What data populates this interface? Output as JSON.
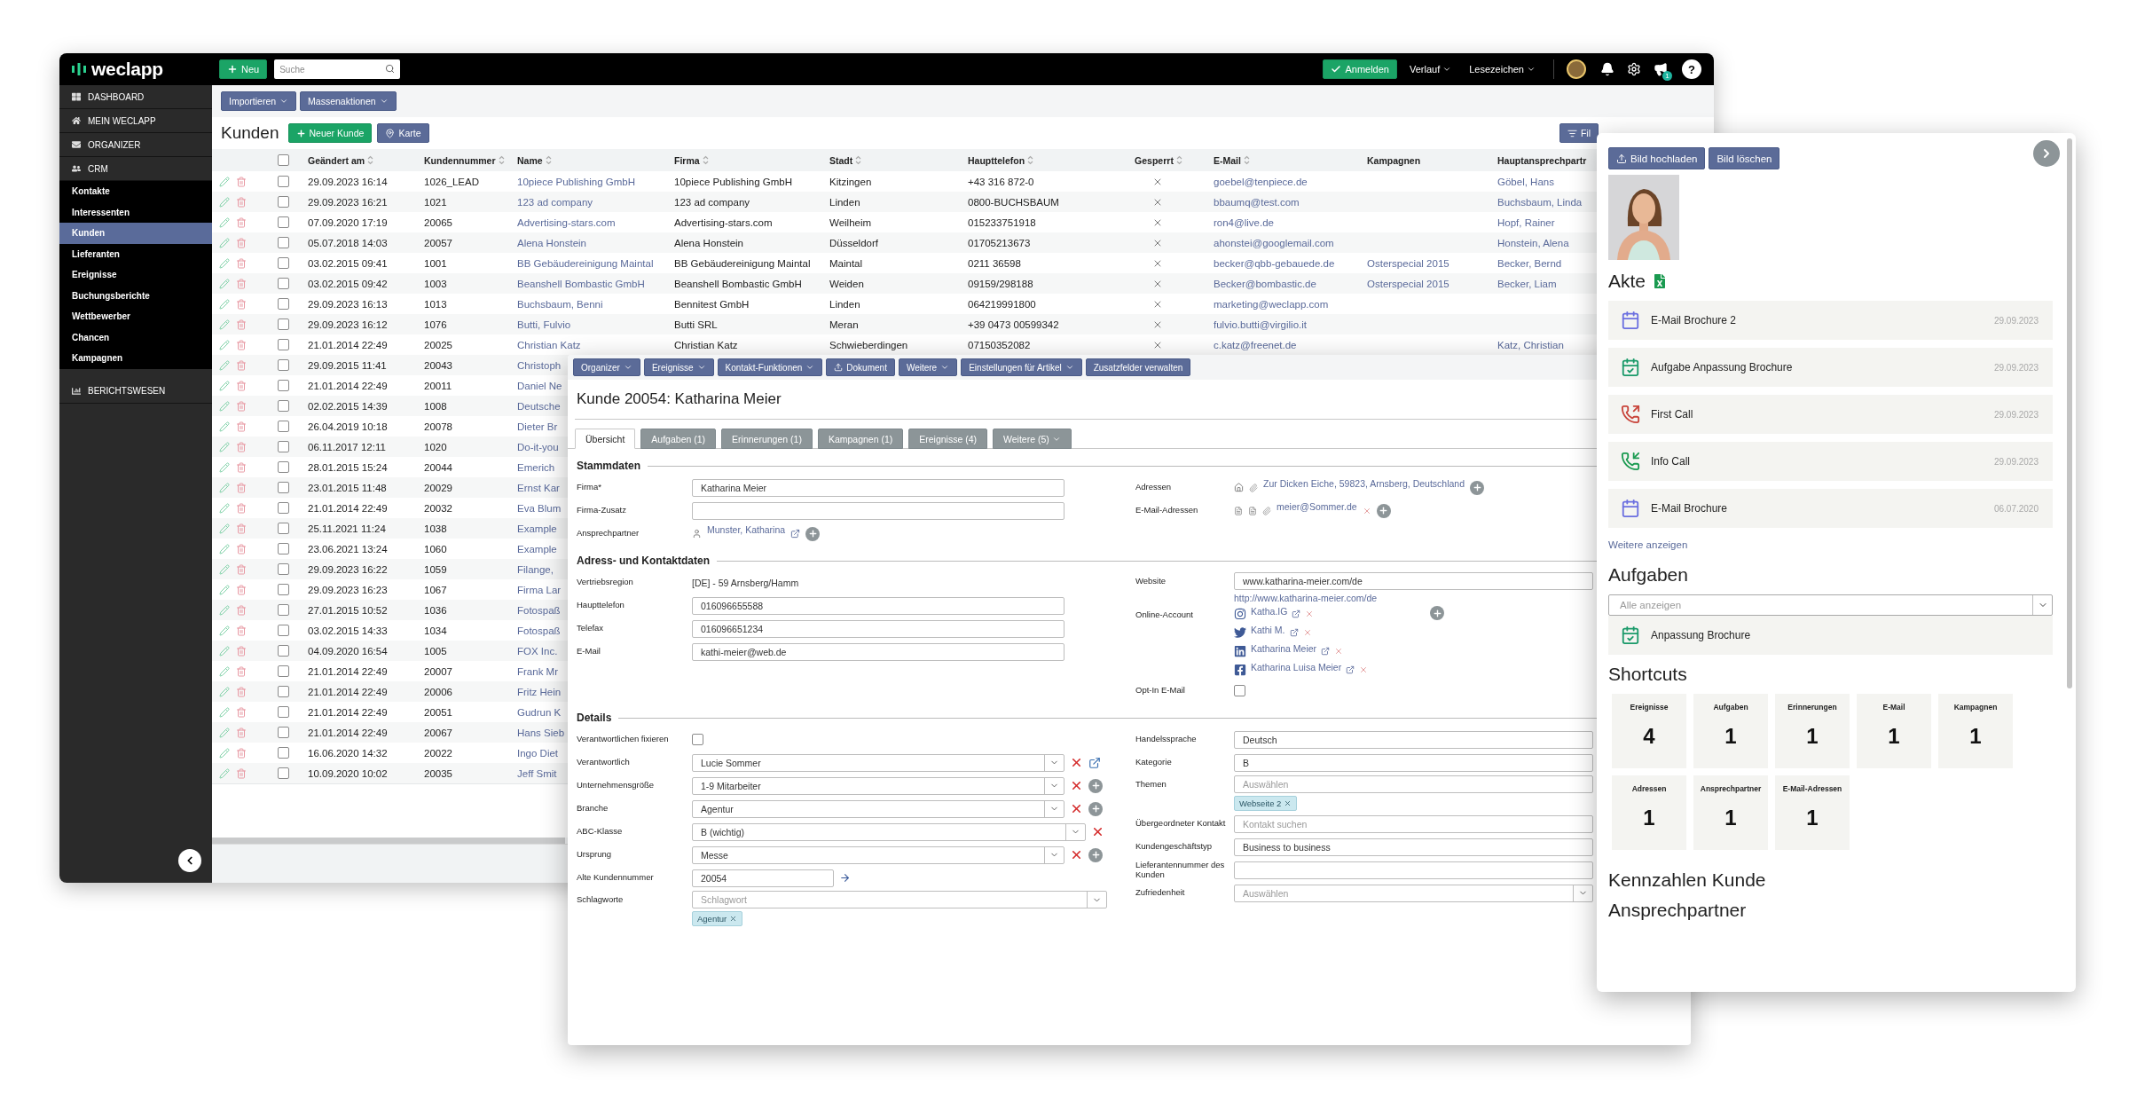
{
  "back_window": {
    "logo": "weclapp",
    "new_button": "Neu",
    "search": {
      "placeholder": "Suche"
    },
    "login_button": "Anmelden",
    "menus": [
      "Verlauf",
      "Lesezeichen"
    ],
    "notification_badge": "1",
    "help_button": "?",
    "sidebar": {
      "items": [
        {
          "label": "DASHBOARD",
          "kind": "section",
          "selected": false
        },
        {
          "label": "MEIN WECLAPP",
          "kind": "section",
          "selected": false
        },
        {
          "label": "ORGANIZER",
          "kind": "section",
          "selected": false
        },
        {
          "label": "CRM",
          "kind": "section",
          "selected": false
        },
        {
          "label": "Kontakte",
          "kind": "item",
          "selected": false
        },
        {
          "label": "Interessenten",
          "kind": "item",
          "selected": false
        },
        {
          "label": "Kunden",
          "kind": "item",
          "selected": true
        },
        {
          "label": "Lieferanten",
          "kind": "item",
          "selected": false
        },
        {
          "label": "Ereignisse",
          "kind": "item",
          "selected": false
        },
        {
          "label": "Buchungsberichte",
          "kind": "item",
          "selected": false
        },
        {
          "label": "Wettbewerber",
          "kind": "item",
          "selected": false
        },
        {
          "label": "Chancen",
          "kind": "item",
          "selected": false
        },
        {
          "label": "Kampagnen",
          "kind": "item",
          "selected": false
        },
        {
          "label": "BERICHTSWESEN",
          "kind": "section",
          "selected": false
        }
      ]
    },
    "toolbar_buttons": [
      "Importieren",
      "Massenaktionen"
    ],
    "page_title": "Kunden",
    "title_buttons": [
      {
        "label": "Neuer Kunde",
        "kind": "primary"
      },
      {
        "label": "Karte",
        "kind": "map"
      }
    ],
    "filter_button": "Fil",
    "table": {
      "select_all": {
        "checked": false
      },
      "columns": [
        {
          "label": "Geändert am",
          "sortable": true
        },
        {
          "label": "Kundennummer",
          "sortable": true
        },
        {
          "label": "Name",
          "sortable": true
        },
        {
          "label": "Firma",
          "sortable": true
        },
        {
          "label": "Stadt",
          "sortable": true
        },
        {
          "label": "Haupttelefon",
          "sortable": true
        },
        {
          "label": "Gesperrt",
          "sortable": true
        },
        {
          "label": "E-Mail",
          "sortable": true
        },
        {
          "label": "Kampagnen",
          "sortable": false
        },
        {
          "label": "Hauptansprechpartr",
          "sortable": false
        }
      ],
      "rows": [
        {
          "checked": false,
          "changed": "29.09.2023 16:14",
          "number": "1026_LEAD",
          "name": "10piece Publishing GmbH",
          "company": "10piece Publishing GmbH",
          "city": "Kitzingen",
          "phone": "+43 316 872-0",
          "locked": false,
          "email": "goebel@tenpiece.de",
          "contact": "Göbel, Hans"
        },
        {
          "checked": false,
          "changed": "29.09.2023 16:21",
          "number": "1021",
          "name": "123 ad company",
          "company": "123 ad company",
          "city": "Linden",
          "phone": "0800-BUCHSBAUM",
          "locked": false,
          "email": "bbaumq@test.com",
          "contact": "Buchsbaum, Linda"
        },
        {
          "checked": false,
          "changed": "07.09.2020 17:19",
          "number": "20065",
          "name": "Advertising-stars.com",
          "company": "Advertising-stars.com",
          "city": "Weilheim",
          "phone": "015233751918",
          "locked": false,
          "email": "ron4@live.de",
          "contact": "Hopf, Rainer"
        },
        {
          "checked": false,
          "changed": "05.07.2018 14:03",
          "number": "20057",
          "name": "Alena Honstein",
          "company": "Alena Honstein",
          "city": "Düsseldorf",
          "phone": "01705213673",
          "locked": false,
          "email": "ahonstei@googlemail.com",
          "contact": "Honstein, Alena"
        },
        {
          "checked": false,
          "changed": "03.02.2015 09:41",
          "number": "1001",
          "name": "BB Gebäudereinigung Maintal",
          "company": "BB Gebäudereinigung Maintal",
          "city": "Maintal",
          "phone": "0211 36598",
          "locked": false,
          "email": "becker@qbb-gebauede.de",
          "campaign": "Osterspecial 2015",
          "contact": "Becker, Bernd"
        },
        {
          "checked": false,
          "changed": "03.02.2015 09:42",
          "number": "1003",
          "name": "Beanshell Bombastic GmbH",
          "company": "Beanshell Bombastic GmbH",
          "city": "Weiden",
          "phone": "09159/298188",
          "locked": false,
          "email": "Becker@bombastic.de",
          "campaign": "Osterspecial 2015",
          "contact": "Becker, Liam"
        },
        {
          "checked": false,
          "changed": "29.09.2023 16:13",
          "number": "1013",
          "name": "Buchsbaum, Benni",
          "company": "Bennitest GmbH",
          "city": "Linden",
          "phone": "064219991800",
          "locked": false,
          "email": "marketing@weclapp.com"
        },
        {
          "checked": false,
          "changed": "29.09.2023 16:12",
          "number": "1076",
          "name": "Butti, Fulvio",
          "company": "Butti SRL",
          "city": "Meran",
          "phone": "+39 0473 00599342",
          "locked": false,
          "email": "fulvio.butti@virgilio.it"
        },
        {
          "checked": false,
          "changed": "21.01.2014 22:49",
          "number": "20025",
          "name": "Christian Katz",
          "company": "Christian Katz",
          "city": "Schwieberdingen",
          "phone": "07150352082",
          "locked": false,
          "email": "c.katz@freenet.de",
          "contact": "Katz, Christian"
        },
        {
          "checked": false,
          "changed": "29.09.2015 11:41",
          "number": "20043",
          "name": "Christoph"
        },
        {
          "checked": false,
          "changed": "21.01.2014 22:49",
          "number": "20011",
          "name": "Daniel Ne"
        },
        {
          "checked": false,
          "changed": "02.02.2015 14:39",
          "number": "1008",
          "name": "Deutsche"
        },
        {
          "checked": false,
          "changed": "26.04.2019 10:18",
          "number": "20078",
          "name": "Dieter Br"
        },
        {
          "checked": false,
          "changed": "06.11.2017 12:11",
          "number": "1020",
          "name": "Do-it-you"
        },
        {
          "checked": false,
          "changed": "28.01.2015 15:24",
          "number": "20044",
          "name": "Emerich"
        },
        {
          "checked": false,
          "changed": "23.01.2015 11:48",
          "number": "20029",
          "name": "Ernst Kar"
        },
        {
          "checked": false,
          "changed": "21.01.2014 22:49",
          "number": "20032",
          "name": "Eva Blum"
        },
        {
          "checked": false,
          "changed": "25.11.2021 11:24",
          "number": "1038",
          "name": "Example"
        },
        {
          "checked": false,
          "changed": "23.06.2021 13:24",
          "number": "1060",
          "name": "Example"
        },
        {
          "checked": false,
          "changed": "29.09.2023 16:22",
          "number": "1059",
          "name": "Filange,"
        },
        {
          "checked": false,
          "changed": "29.09.2023 16:23",
          "number": "1067",
          "name": "Firma Lar"
        },
        {
          "checked": false,
          "changed": "27.01.2015 10:52",
          "number": "1036",
          "name": "Fotospaß"
        },
        {
          "checked": false,
          "changed": "03.02.2015 14:33",
          "number": "1034",
          "name": "Fotospaß"
        },
        {
          "checked": false,
          "changed": "04.09.2020 16:54",
          "number": "1005",
          "name": "FOX Inc."
        },
        {
          "checked": false,
          "changed": "21.01.2014 22:49",
          "number": "20007",
          "name": "Frank Mr"
        },
        {
          "checked": false,
          "changed": "21.01.2014 22:49",
          "number": "20006",
          "name": "Fritz Hein"
        },
        {
          "checked": false,
          "changed": "21.01.2014 22:49",
          "number": "20051",
          "name": "Gudrun K"
        },
        {
          "checked": false,
          "changed": "21.01.2014 22:49",
          "number": "20067",
          "name": "Hans Sieb"
        },
        {
          "checked": false,
          "changed": "16.06.2020 14:32",
          "number": "20022",
          "name": "Ingo Diet"
        },
        {
          "checked": false,
          "changed": "10.09.2020 10:02",
          "number": "20035",
          "name": "Jeff Smit"
        }
      ]
    }
  },
  "detail_window": {
    "toolbar": [
      {
        "label": "Organizer",
        "kind": "menu"
      },
      {
        "label": "Ereignisse",
        "kind": "menu"
      },
      {
        "label": "Kontakt-Funktionen",
        "kind": "menu"
      },
      {
        "label": "Dokument",
        "kind": "upload"
      },
      {
        "label": "Weitere",
        "kind": "menu"
      },
      {
        "label": "Einstellungen für Artikel",
        "kind": "menu"
      },
      {
        "label": "Zusatzfelder verwalten",
        "kind": "plain"
      }
    ],
    "title": "Kunde 20054: Katharina Meier",
    "tabs": [
      {
        "label": "Übersicht",
        "kind": "tab",
        "selected": true
      },
      {
        "label": "Aufgaben (1)",
        "kind": "tab",
        "selected": false
      },
      {
        "label": "Erinnerungen (1)",
        "kind": "tab",
        "selected": false
      },
      {
        "label": "Kampagnen (1)",
        "kind": "tab",
        "selected": false
      },
      {
        "label": "Ereignisse (4)",
        "kind": "tab",
        "selected": false
      },
      {
        "label": "Weitere (5)",
        "kind": "menu",
        "selected": false
      }
    ],
    "sections": [
      {
        "title": "Stammdaten",
        "left": [
          {
            "kind": "input",
            "label": "Firma*",
            "value": "Katharina Meier"
          },
          {
            "kind": "input",
            "label": "Firma-Zusatz"
          },
          {
            "kind": "person",
            "label": "Ansprechpartner",
            "value": "Munster, Katharina"
          }
        ],
        "right": [
          {
            "kind": "address",
            "label": "Adressen",
            "value": "Zur Dicken Eiche, 59823, Arnsberg, Deutschland"
          },
          {
            "kind": "email",
            "label": "E-Mail-Adressen",
            "value": "meier@Sommer.de"
          }
        ]
      },
      {
        "title": "Adress- und Kontaktdaten",
        "left": [
          {
            "kind": "text",
            "label": "Vertriebsregion",
            "value": "[DE] - 59 Arnsberg/Hamm"
          },
          {
            "kind": "input",
            "label": "Haupttelefon",
            "value": "016096655588"
          },
          {
            "kind": "input",
            "label": "Telefax",
            "value": "016096651234"
          },
          {
            "kind": "input",
            "label": "E-Mail",
            "value": "kathi-meier@web.de"
          }
        ],
        "right": [
          {
            "kind": "website",
            "label": "Website",
            "value": "www.katharina-meier.com/de",
            "link": "http://www.katharina-meier.com/de"
          },
          {
            "kind": "accounts",
            "label": "Online-Account",
            "accounts": [
              "Katha.IG",
              "Kathi M.",
              "Katharina Meier",
              "Katharina Luisa Meier"
            ]
          },
          {
            "kind": "checkbox",
            "label": "Opt-In E-Mail",
            "checked": false
          }
        ]
      },
      {
        "title": "Details",
        "left": [
          {
            "kind": "checkbox",
            "label": "Verantwortlichen fixieren",
            "checked": false
          },
          {
            "kind": "select",
            "label": "Verantwortlich",
            "value": "Lucie Sommer",
            "clearable": true,
            "open_button": true,
            "add_button": false
          },
          {
            "kind": "select",
            "label": "Unternehmensgröße",
            "value": "1-9 Mitarbeiter",
            "clearable": true,
            "open_button": false,
            "add_button": true
          },
          {
            "kind": "select",
            "label": "Branche",
            "value": "Agentur",
            "clearable": true,
            "open_button": false,
            "add_button": true
          },
          {
            "kind": "select",
            "label": "ABC-Klasse",
            "value": "B (wichtig)",
            "clearable": true,
            "open_button": false,
            "add_button": false
          },
          {
            "kind": "select",
            "label": "Ursprung",
            "value": "Messe",
            "clearable": true,
            "open_button": false,
            "add_button": true
          },
          {
            "kind": "input-arrow",
            "label": "Alte Kundennummer",
            "value": "20054"
          },
          {
            "kind": "tags",
            "label": "Schlagworte",
            "placeholder": "Schlagwort",
            "dropdown": true,
            "tags": [
              "Agentur"
            ]
          }
        ],
        "right": [
          {
            "kind": "input",
            "label": "Handelssprache",
            "value": "Deutsch"
          },
          {
            "kind": "input",
            "label": "Kategorie",
            "value": "B"
          },
          {
            "kind": "tags",
            "label": "Themen",
            "placeholder": "Auswählen",
            "dropdown": false,
            "tags": [
              "Webseite 2"
            ]
          },
          {
            "kind": "input",
            "label": "Übergeordneter Kontakt",
            "placeholder": "Kontakt suchen"
          },
          {
            "kind": "input",
            "label": "Kundengeschäftstyp",
            "value": "Business to business"
          },
          {
            "kind": "input",
            "label": "Lieferantennummer des Kunden"
          },
          {
            "kind": "select",
            "label": "Zufriedenheit",
            "placeholder": "Auswählen",
            "clearable": false,
            "open_button": false,
            "add_button": false
          }
        ]
      }
    ]
  },
  "side_panel": {
    "buttons": [
      "Bild hochladen",
      "Bild löschen"
    ],
    "photo": {
      "kind": "picture"
    },
    "file_title": "Akte",
    "file_items": [
      {
        "kind": "email",
        "title": "E-Mail Brochure 2",
        "date": "29.09.2023"
      },
      {
        "kind": "task",
        "title": "Aufgabe Anpassung Brochure",
        "date": "29.09.2023"
      },
      {
        "kind": "call-out",
        "title": "First Call",
        "date": "29.09.2023"
      },
      {
        "kind": "call-in",
        "title": "Info Call",
        "date": "29.09.2023"
      },
      {
        "kind": "email",
        "title": "E-Mail Brochure",
        "date": "06.07.2020"
      }
    ],
    "more_link": "Weitere anzeigen",
    "tasks_title": "Aufgaben",
    "tasks_filter": "Alle anzeigen",
    "tasks": [
      {
        "kind": "task",
        "title": "Anpassung Brochure"
      }
    ],
    "shortcuts_title": "Shortcuts",
    "shortcuts": [
      {
        "label": "Ereignisse",
        "count": "4"
      },
      {
        "label": "Aufgaben",
        "count": "1"
      },
      {
        "label": "Erinnerungen",
        "count": "1"
      },
      {
        "label": "E-Mail",
        "count": "1"
      },
      {
        "label": "Kampagnen",
        "count": "1"
      },
      {
        "label": "Adressen",
        "count": "1"
      },
      {
        "label": "Ansprechpartner",
        "count": "1"
      },
      {
        "label": "E-Mail-Adressen",
        "count": "1"
      }
    ],
    "headings": [
      "Kennzahlen Kunde",
      "Ansprechpartner"
    ]
  }
}
